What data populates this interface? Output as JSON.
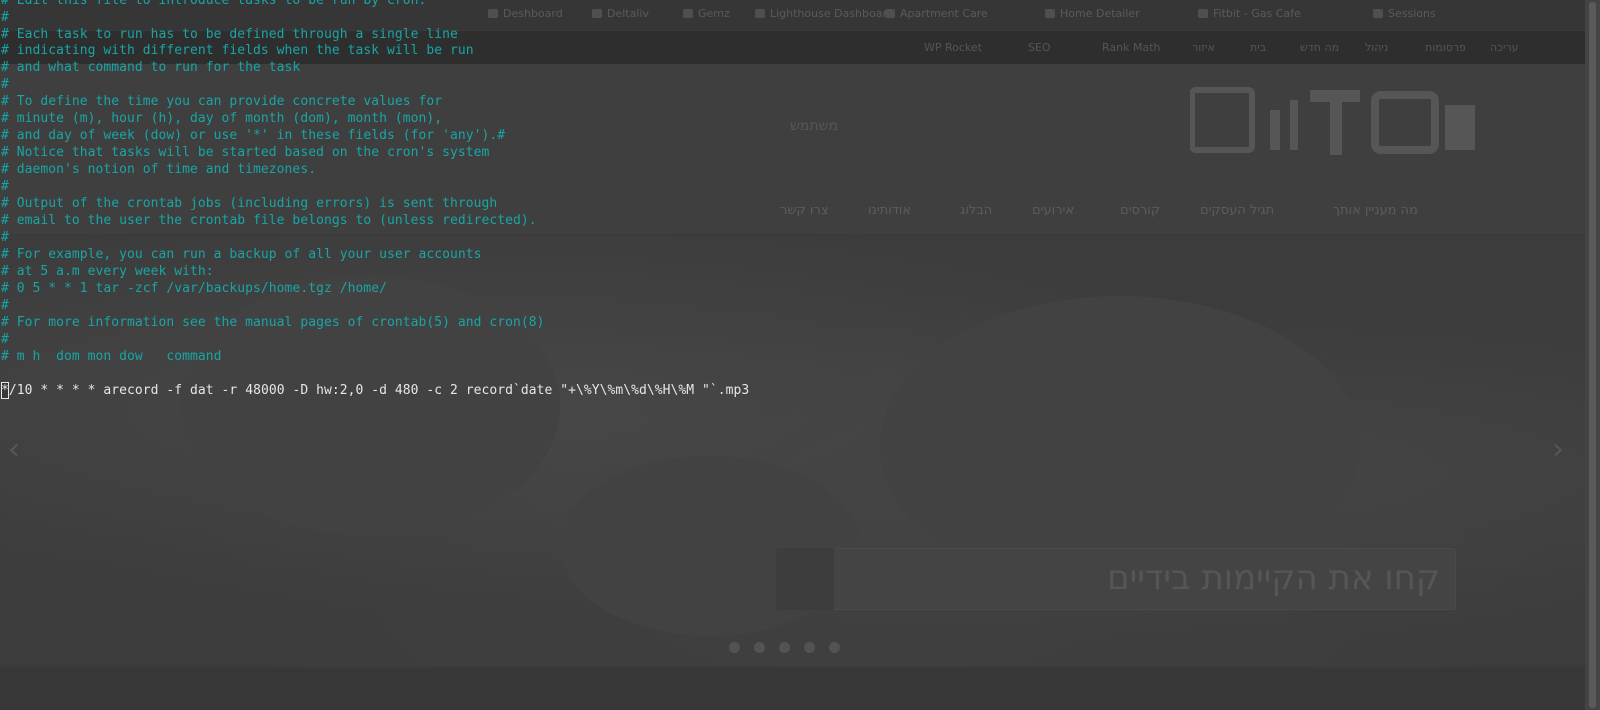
{
  "background_browser": {
    "bookmarks": [
      "Deshboard",
      "Deltaliv",
      "Gemz",
      "Lighthouse Dashboard",
      "Apartment Care",
      "Home Detailer",
      "Fitbit - Gas Cafe",
      "Sessions"
    ],
    "admin_bar": [
      "WP Rocket",
      "SEO",
      "Rank Math",
      "איזור",
      "בית",
      "מה חדש",
      "ניהול",
      "פרסומות",
      "עריכה"
    ],
    "phone": "משתמש",
    "nav_items": [
      "מה מעניין אותך",
      "תגיל העסקים",
      "קורסים",
      "אירועים",
      "הבלוג",
      "אודותינו",
      "צרו קשר"
    ],
    "search_text": "קחו את הקיימות בידיים",
    "prev_arrow": "‹",
    "next_arrow": "›"
  },
  "terminal": {
    "lines": [
      {
        "kind": "comment",
        "text": "# Edit this file to introduce tasks to be run by cron."
      },
      {
        "kind": "comment",
        "text": "#"
      },
      {
        "kind": "comment",
        "text": "# Each task to run has to be defined through a single line"
      },
      {
        "kind": "comment",
        "text": "# indicating with different fields when the task will be run"
      },
      {
        "kind": "comment",
        "text": "# and what command to run for the task"
      },
      {
        "kind": "comment",
        "text": "#"
      },
      {
        "kind": "comment",
        "text": "# To define the time you can provide concrete values for"
      },
      {
        "kind": "comment",
        "text": "# minute (m), hour (h), day of month (dom), month (mon),"
      },
      {
        "kind": "comment",
        "text": "# and day of week (dow) or use '*' in these fields (for 'any').#"
      },
      {
        "kind": "comment",
        "text": "# Notice that tasks will be started based on the cron's system"
      },
      {
        "kind": "comment",
        "text": "# daemon's notion of time and timezones."
      },
      {
        "kind": "comment",
        "text": "#"
      },
      {
        "kind": "comment",
        "text": "# Output of the crontab jobs (including errors) is sent through"
      },
      {
        "kind": "comment",
        "text": "# email to the user the crontab file belongs to (unless redirected)."
      },
      {
        "kind": "comment",
        "text": "#"
      },
      {
        "kind": "comment",
        "text": "# For example, you can run a backup of all your user accounts"
      },
      {
        "kind": "comment",
        "text": "# at 5 a.m every week with:"
      },
      {
        "kind": "comment",
        "text": "# 0 5 * * 1 tar -zcf /var/backups/home.tgz /home/"
      },
      {
        "kind": "comment",
        "text": "#"
      },
      {
        "kind": "comment",
        "text": "# For more information see the manual pages of crontab(5) and cron(8)"
      },
      {
        "kind": "comment",
        "text": "#"
      },
      {
        "kind": "comment",
        "text": "# m h  dom mon dow   command"
      },
      {
        "kind": "blank",
        "text": ""
      },
      {
        "kind": "command",
        "cursor_char": "*",
        "text": "/10 * * * * arecord -f dat -r 48000 -D hw:2,0 -d 480 -c 2 record`date \"+\\%Y\\%m\\%d\\%H\\%M \"`.mp3"
      }
    ]
  }
}
